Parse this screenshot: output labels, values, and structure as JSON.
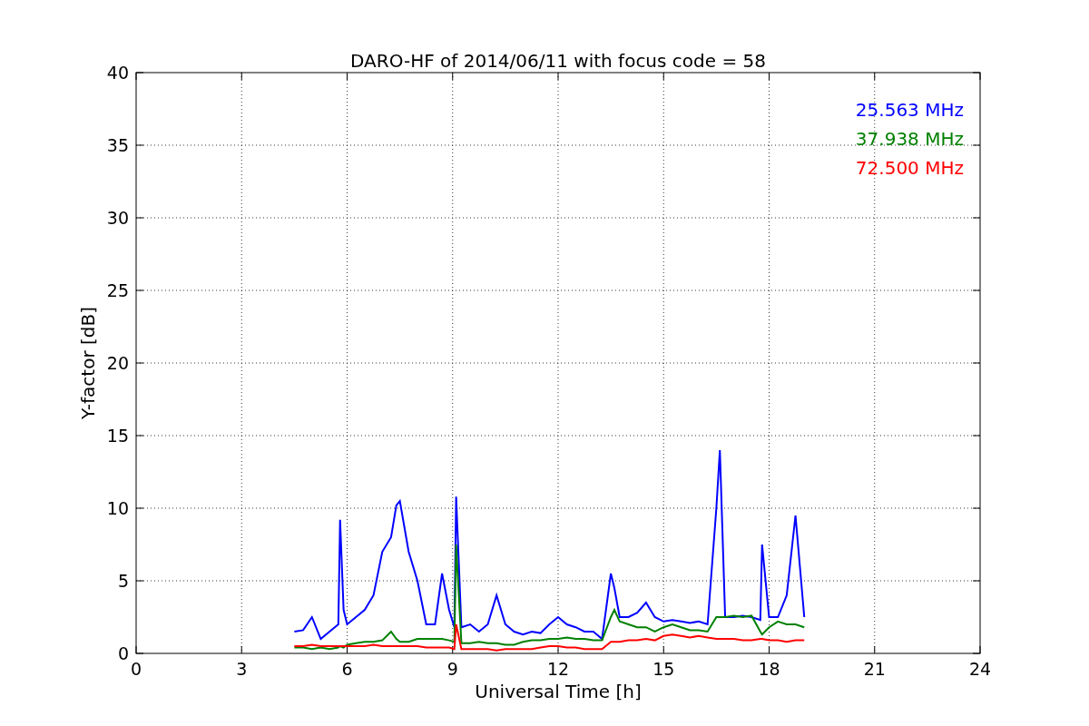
{
  "figure": {
    "chart_data": {
      "type": "line",
      "title": "DARO-HF of 2014/06/11 with focus code = 58",
      "xlabel": "Universal Time [h]",
      "ylabel": "Y-factor [dB]",
      "x": [
        4.5,
        4.75,
        5,
        5.25,
        5.5,
        5.75,
        5.8,
        5.9,
        6,
        6.25,
        6.5,
        6.75,
        7,
        7.25,
        7.4,
        7.5,
        7.75,
        8,
        8.25,
        8.5,
        8.7,
        8.9,
        9.05,
        9.1,
        9.25,
        9.5,
        9.75,
        10,
        10.25,
        10.5,
        10.75,
        11,
        11.25,
        11.5,
        11.75,
        12,
        12.25,
        12.5,
        12.75,
        13,
        13.25,
        13.5,
        13.6,
        13.75,
        14,
        14.25,
        14.5,
        14.75,
        15,
        15.25,
        15.5,
        15.75,
        16,
        16.25,
        16.5,
        16.6,
        16.75,
        17,
        17.25,
        17.5,
        17.75,
        17.8,
        18,
        18.25,
        18.5,
        18.75,
        19
      ],
      "series": [
        {
          "name": "25.563 MHz",
          "color": "#0000ff",
          "values": [
            1.5,
            1.6,
            2.5,
            1.0,
            1.5,
            2.0,
            9.2,
            3.0,
            2.0,
            2.5,
            3.0,
            4.0,
            7.0,
            8.0,
            10.2,
            10.5,
            7.0,
            5.0,
            2.0,
            2.0,
            5.5,
            3.0,
            1.8,
            10.8,
            1.8,
            2.0,
            1.5,
            2.0,
            4.0,
            2.0,
            1.5,
            1.3,
            1.5,
            1.4,
            2.0,
            2.5,
            2.0,
            1.8,
            1.5,
            1.5,
            1.0,
            5.5,
            4.5,
            2.5,
            2.5,
            2.8,
            3.5,
            2.5,
            2.2,
            2.3,
            2.2,
            2.1,
            2.2,
            2.0,
            10.0,
            14.0,
            2.5,
            2.5,
            2.6,
            2.5,
            2.3,
            7.5,
            2.5,
            2.5,
            4.0,
            9.5,
            2.5
          ]
        },
        {
          "name": "37.938 MHz",
          "color": "#008000",
          "values": [
            0.4,
            0.4,
            0.3,
            0.4,
            0.3,
            0.4,
            0.5,
            0.4,
            0.6,
            0.7,
            0.8,
            0.8,
            0.9,
            1.5,
            1.0,
            0.8,
            0.8,
            1.0,
            1.0,
            1.0,
            1.0,
            0.9,
            0.8,
            7.5,
            0.7,
            0.7,
            0.8,
            0.7,
            0.7,
            0.6,
            0.6,
            0.8,
            0.9,
            0.9,
            1.0,
            1.0,
            1.1,
            1.0,
            1.0,
            0.9,
            0.9,
            2.5,
            3.0,
            2.2,
            2.0,
            1.8,
            1.8,
            1.5,
            1.8,
            2.0,
            1.8,
            1.6,
            1.6,
            1.5,
            2.5,
            2.5,
            2.5,
            2.6,
            2.5,
            2.6,
            1.5,
            1.3,
            1.8,
            2.2,
            2.0,
            2.0,
            1.8
          ]
        },
        {
          "name": "72.500 MHz",
          "color": "#ff0000",
          "values": [
            0.5,
            0.5,
            0.6,
            0.5,
            0.5,
            0.5,
            0.5,
            0.5,
            0.5,
            0.5,
            0.5,
            0.6,
            0.5,
            0.5,
            0.5,
            0.5,
            0.5,
            0.5,
            0.4,
            0.4,
            0.4,
            0.4,
            0.3,
            2.0,
            0.3,
            0.3,
            0.3,
            0.3,
            0.2,
            0.3,
            0.3,
            0.3,
            0.3,
            0.4,
            0.5,
            0.5,
            0.4,
            0.4,
            0.3,
            0.3,
            0.3,
            0.8,
            0.8,
            0.8,
            0.9,
            0.9,
            1.0,
            0.9,
            1.2,
            1.3,
            1.2,
            1.1,
            1.2,
            1.1,
            1.0,
            1.0,
            1.0,
            1.0,
            0.9,
            0.9,
            1.0,
            1.0,
            0.9,
            0.9,
            0.8,
            0.9,
            0.9
          ]
        }
      ],
      "xlim": [
        0,
        24
      ],
      "ylim": [
        0,
        40
      ],
      "xticks": [
        0,
        3,
        6,
        9,
        12,
        15,
        18,
        21,
        24
      ],
      "yticks": [
        0,
        5,
        10,
        15,
        20,
        25,
        30,
        35,
        40
      ],
      "grid": true
    }
  }
}
